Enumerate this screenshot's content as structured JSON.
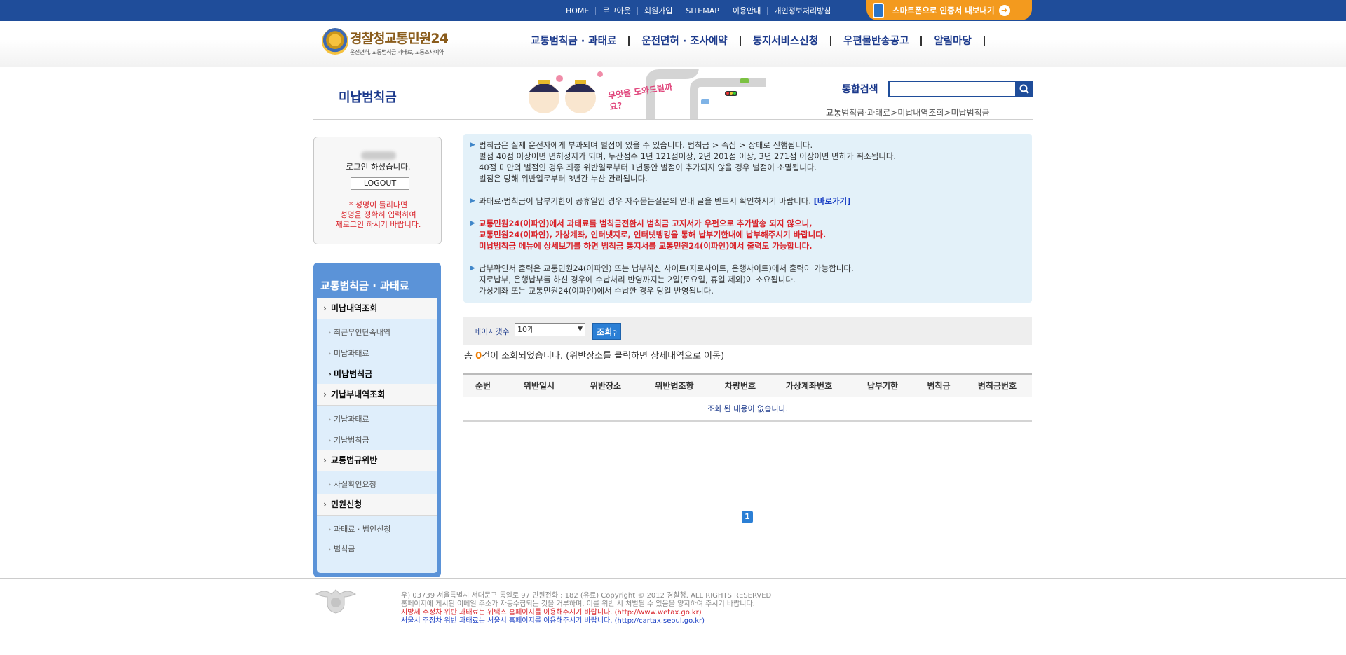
{
  "top": {
    "links": [
      "HOME",
      "로그아웃",
      "회원가입",
      "SITEMAP",
      "이용안내",
      "개인정보처리방침"
    ],
    "smart_label": "스마트폰으로 인증서 내보내기"
  },
  "header": {
    "logo_main": "경찰청교통민원24",
    "logo_sub": "운전면허, 교통범칙금 과태료, 교통조사예약",
    "nav": [
      "교통범칙금 · 과태료",
      "운전면허 · 조사예약",
      "통지서비스신청",
      "우편물반송공고",
      "알림마당"
    ]
  },
  "page": {
    "title": "미납범칙금",
    "banner_text": "무엇을 도와드릴까요?",
    "search_label": "통합검색",
    "breadcrumb": "교통범칙금·과태료>미납내역조회>미납범칙금"
  },
  "login": {
    "message": "로그인 하셨습니다.",
    "logout": "LOGOUT",
    "note": "* 성명이 틀리다면\n성명을 정확히 입력하여\n재로그인 하시기 바랍니다."
  },
  "lnb": {
    "title": "교통범칙금 · 과태료",
    "sections": [
      {
        "label": "미납내역조회",
        "items": [
          "최근무인단속내역",
          "미납과태료",
          "미납범칙금"
        ]
      },
      {
        "label": "기납부내역조회",
        "items": [
          "기납과태료",
          "기납범칙금"
        ]
      },
      {
        "label": "교통법규위반",
        "items": [
          "사실확인요청"
        ]
      },
      {
        "label": "민원신청",
        "items": [
          "과태료 · 범인신청",
          "범칙금"
        ]
      }
    ]
  },
  "info": {
    "p1": "범칙금은 실제 운전자에게 부과되며 벌점이 있을 수 있습니다. 범칙금 > 즉심 > 상태로 진행됩니다.\n  벌점 40점 이상이면 면허정지가 되며, 누산점수 1년 121점이상, 2년 201점 이상, 3년 271점 이상이면 면허가 취소됩니다.\n  40점 미만의 벌점인 경우 최종 위반일로부터 1년동안 벌점이 추가되지 않을 경우 벌점이 소멸됩니다.\n  벌점은 당해 위반일로부터 3년간 누산 관리됩니다.",
    "p2": "과태료·범칙금이 납부기한이 공휴일인 경우 자주묻는질문의 안내 글을 반드시 확인하시기 바랍니다.",
    "p2_link": "[바로가기]",
    "p3": "교통민원24(이파인)에서 과태료를 범칙금전환시 범칙금 고지서가 우편으로 추가발송 되지 않으니,\n  교통민원24(이파인), 가상계좌, 인터넷지로, 인터넷뱅킹을 통해 납부기한내에 납부해주시기 바랍니다.\n  미납범칙금 메뉴에 상세보기를 하면 범칙금 통지서를 교통민원24(이파인)에서 출력도 가능합니다.",
    "p4": " 납부확인서 출력은 교통민원24(이파인) 또는 납부하신 사이트(지로사이트, 은행사이트)에서 출력이 가능합니다.\n   지로납부, 은행납부를 하신 경우에 수납처리 반영까지는 2일(토요일, 휴일 제외)이 소요됩니다.\n   가상계좌 또는 교통민원24(이파인)에서 수납한 경우 당일 반영됩니다."
  },
  "controls": {
    "pagesize_label": "페이지갯수",
    "pagesize_value": "10개",
    "search_button": "조회",
    "count_prefix": "총 ",
    "count": "0",
    "count_suffix": "건이 조회되었습니다. (위반장소를 클릭하면 상세내역으로 이동)"
  },
  "table": {
    "headers": [
      "순번",
      "위반일시",
      "위반장소",
      "위반법조항",
      "차량번호",
      "가상계좌번호",
      "납부기한",
      "범칙금",
      "범칙금번호"
    ],
    "empty": "조회 된 내용이 없습니다."
  },
  "pager": {
    "current": "1"
  },
  "footer": {
    "line1": "우) 03739 서울특별시 서대문구 통일로 97  민원전화 : 182 (유료)        Copyright © 2012 경찰청. ALL RIGHTS RESERVED",
    "line2": "홈페이지에 게시된 이메일 주소가 자동수집되는 것을 거부하며, 이를 위반 시 처벌될 수 있음을 양지하여 주시기 바랍니다.",
    "line3": "지방세 주정차 위반 과태료는 위택스 홈페이지를 이용해주시기 바랍니다. (http://www.wetax.go.kr)",
    "line4": "서울시 주정차 위반 과태료는 서울시 홈페이지를 이용해주시기 바랍니다. (http://cartax.seoul.go.kr)"
  },
  "colors": {
    "brand": "#1f4d9a",
    "accent": "#f39a1e",
    "warning": "#d9232a"
  }
}
